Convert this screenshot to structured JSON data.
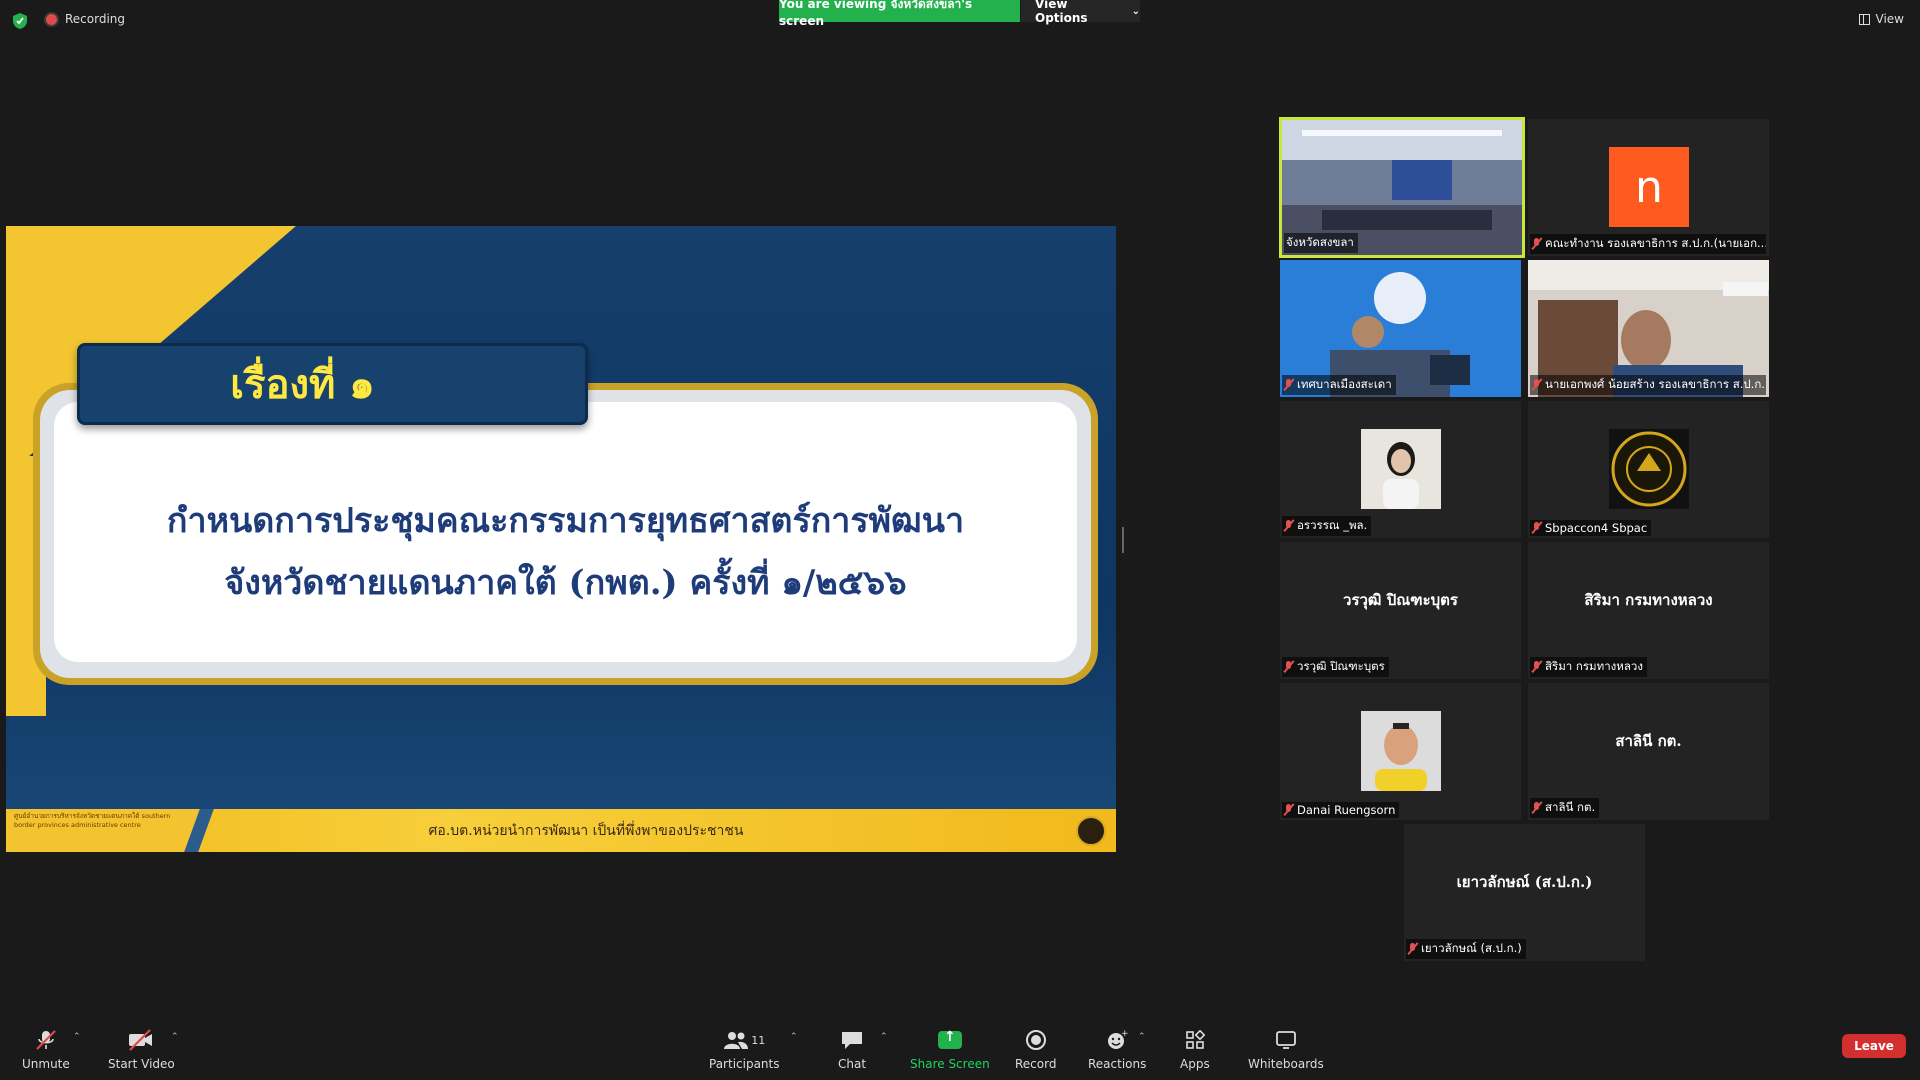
{
  "topbar": {
    "recording_label": "Recording",
    "viewing_banner": "You are viewing จังหวัดสงขลา's screen",
    "view_options_label": "View Options",
    "view_label": "View"
  },
  "slide": {
    "topic_tab": "เรื่องที่ ๑",
    "title_line1": "กำหนดการประชุมคณะกรรมการยุทธศาสตร์การพัฒนา",
    "title_line2": "จังหวัดชายแดนภาคใต้ (กพต.) ครั้งที่ ๑/๒๕๖๖",
    "footer_org": "ศูนย์อำนวยการบริหารจังหวัดชายแดนภาคใต้ southern border provinces administrative centre",
    "footer_motto": "ศอ.บต.หน่วยนำการพัฒนา เป็นที่พึ่งพาของประชาชน"
  },
  "participants": [
    {
      "name": "จังหวัดสงขลา",
      "active": true,
      "type": "video"
    },
    {
      "name": "คณะทำงาน รองเลขาธิการ ส.ป.ก.(นายเอก...",
      "type": "avatar",
      "avatar_letter": "n",
      "avatar_color": "#ff5a1f"
    },
    {
      "name": "เทศบาลเมืองสะเดา",
      "type": "video"
    },
    {
      "name": "นายเอกพงศ์ น้อยสร้าง รองเลขาธิการ ส.ป.ก.",
      "type": "video"
    },
    {
      "name": "อรวรรณ _พล.",
      "type": "photo"
    },
    {
      "name": "Sbpaccon4 Sbpac",
      "type": "photo"
    },
    {
      "name": "วรวุฒิ ปิณฑะบุตร",
      "display": "วรวุฒิ ปิณฑะบุตร",
      "type": "text"
    },
    {
      "name": "สิริมา กรมทางหลวง",
      "display": "สิริมา กรมทางหลวง",
      "type": "text"
    },
    {
      "name": "Danai Ruengsorn",
      "type": "photo"
    },
    {
      "name": "สาลินี กต.",
      "display": "สาลินี กต.",
      "type": "text"
    },
    {
      "name": "เยาวลักษณ์ (ส.ป.ก.)",
      "display": "เยาวลักษณ์ (ส.ป.ก.)",
      "type": "text"
    }
  ],
  "toolbar": {
    "unmute": "Unmute",
    "start_video": "Start Video",
    "participants": "Participants",
    "participants_count": "11",
    "chat": "Chat",
    "share_screen": "Share Screen",
    "record": "Record",
    "reactions": "Reactions",
    "apps": "Apps",
    "whiteboards": "Whiteboards",
    "leave": "Leave"
  },
  "colors": {
    "active_speaker_border": "#c9e63a",
    "share_green": "#23b14d",
    "leave_red": "#d32f2f"
  }
}
